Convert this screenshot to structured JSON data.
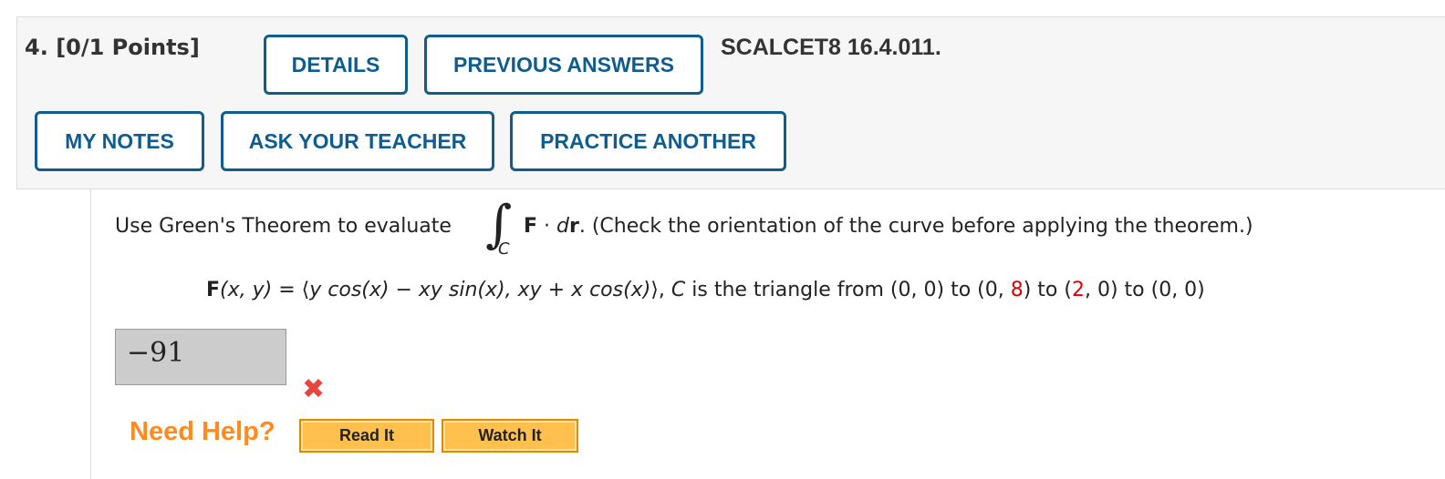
{
  "header": {
    "question_number": "4.",
    "points": "[0/1 Points]",
    "buttons": {
      "details": "DETAILS",
      "previous_answers": "PREVIOUS ANSWERS",
      "my_notes": "MY NOTES",
      "ask_teacher": "ASK YOUR TEACHER",
      "practice_another": "PRACTICE ANOTHER"
    },
    "problem_code": "SCALCET8 16.4.011."
  },
  "problem": {
    "intro": "Use Green's Theorem to evaluate",
    "integral_symbol": "∫",
    "integral_sub": "C",
    "integrand_F": "F",
    "integrand_dot": " · ",
    "integrand_d": "d",
    "integrand_r": "r",
    "note": ".  (Check the orientation of the curve before applying the theorem.)",
    "field": {
      "F": "F",
      "args": "(x, y)",
      "eq": " = ",
      "langle": "⟨",
      "expr1": "y cos(x) − xy sin(x), xy + x cos(x)",
      "rangle": "⟩",
      "comma": ", ",
      "C": "C",
      "desc_start": " is the triangle from (0, 0) to (0, ",
      "num1": "8",
      "desc_mid": ") to (",
      "num2": "2",
      "desc_end": ", 0) to (0, 0)"
    },
    "accent_color": "#e00000"
  },
  "answer": {
    "value": "−91",
    "status_icon": "incorrect-x-icon",
    "status_glyph": "✖"
  },
  "help": {
    "label": "Need Help?",
    "read_it": "Read It",
    "watch_it": "Watch It"
  }
}
